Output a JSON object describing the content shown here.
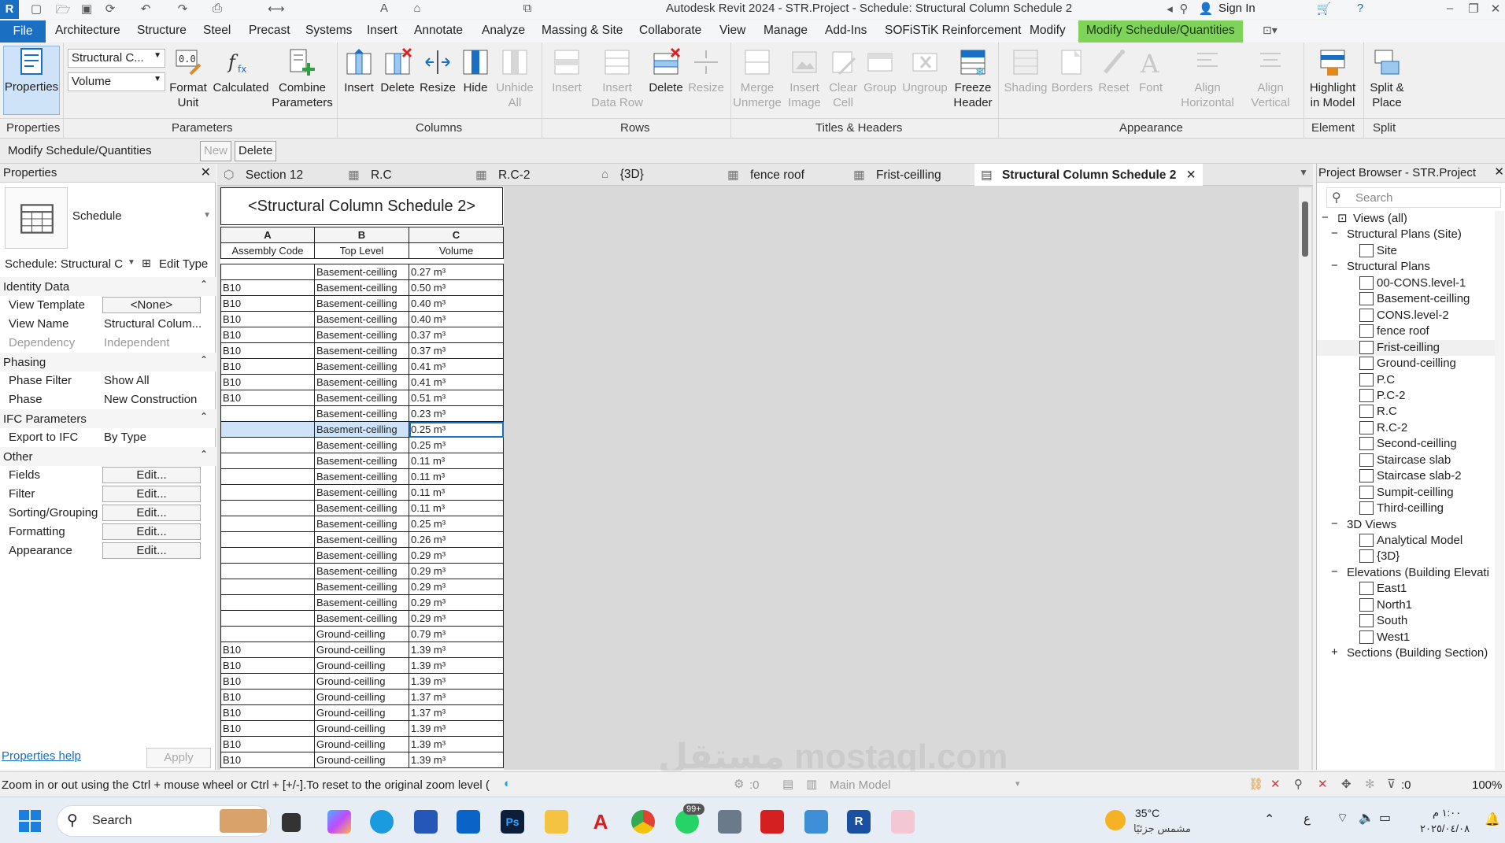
{
  "titlebar": {
    "title": "Autodesk Revit 2024 - STR.Project - Schedule: Structural Column Schedule 2",
    "sign_in": "Sign In"
  },
  "menu_tabs": [
    "File",
    "Architecture",
    "Structure",
    "Steel",
    "Precast",
    "Systems",
    "Insert",
    "Annotate",
    "Analyze",
    "Massing & Site",
    "Collaborate",
    "View",
    "Manage",
    "Add-Ins",
    "SOFiSTiK Reinforcement",
    "Modify",
    "Modify Schedule/Quantities"
  ],
  "ribbon": {
    "properties_label": "Properties",
    "param_dropdown1": "Structural C...",
    "param_dropdown2": "Volume",
    "format_unit": "Format Unit",
    "calculated": "Calculated",
    "combine_parameters": "Combine Parameters",
    "columns": [
      "Insert",
      "Delete",
      "Resize",
      "Hide",
      "Unhide All"
    ],
    "rows": [
      "Insert",
      "Insert Data Row",
      "Delete",
      "Resize"
    ],
    "titles": [
      "Merge Unmerge",
      "Insert Image",
      "Clear Cell",
      "Group",
      "Ungroup",
      "Freeze Header"
    ],
    "appearance": [
      "Shading",
      "Borders",
      "Reset",
      "Font",
      "Align Horizontal",
      "Align Vertical"
    ],
    "element": "Highlight in Model",
    "split": "Split & Place",
    "groups": [
      "Properties",
      "Parameters",
      "Columns",
      "Rows",
      "Titles & Headers",
      "Appearance",
      "Element",
      "Split"
    ]
  },
  "context_bar": {
    "label": "Modify Schedule/Quantities",
    "new": "New",
    "delete": "Delete"
  },
  "properties_panel": {
    "title": "Properties",
    "type_name": "Schedule",
    "selector": "Schedule: Structural C",
    "edit_type": "Edit Type",
    "sections": [
      {
        "name": "Identity Data",
        "rows": [
          [
            "View Template",
            "<None>"
          ],
          [
            "View Name",
            "Structural Colum..."
          ],
          [
            "Dependency",
            "Independent"
          ]
        ]
      },
      {
        "name": "Phasing",
        "rows": [
          [
            "Phase Filter",
            "Show All"
          ],
          [
            "Phase",
            "New Construction"
          ]
        ]
      },
      {
        "name": "IFC Parameters",
        "rows": [
          [
            "Export to IFC",
            "By Type"
          ]
        ]
      },
      {
        "name": "Other",
        "rows": [
          [
            "Fields",
            "Edit..."
          ],
          [
            "Filter",
            "Edit..."
          ],
          [
            "Sorting/Grouping",
            "Edit..."
          ],
          [
            "Formatting",
            "Edit..."
          ],
          [
            "Appearance",
            "Edit..."
          ]
        ]
      }
    ],
    "help_link": "Properties help",
    "apply": "Apply"
  },
  "view_tabs": [
    "Section 12",
    "R.C",
    "R.C-2",
    "{3D}",
    "fence roof",
    "Frist-ceilling",
    "Structural Column Schedule 2"
  ],
  "schedule": {
    "title": "<Structural Column Schedule 2>",
    "col_letters": [
      "A",
      "B",
      "C"
    ],
    "headers": [
      "Assembly Code",
      "Top Level",
      "Volume"
    ],
    "rows": [
      [
        "",
        "Basement-ceilling",
        "0.27 m³"
      ],
      [
        "B10",
        "Basement-ceilling",
        "0.50 m³"
      ],
      [
        "B10",
        "Basement-ceilling",
        "0.40 m³"
      ],
      [
        "B10",
        "Basement-ceilling",
        "0.40 m³"
      ],
      [
        "B10",
        "Basement-ceilling",
        "0.37 m³"
      ],
      [
        "B10",
        "Basement-ceilling",
        "0.37 m³"
      ],
      [
        "B10",
        "Basement-ceilling",
        "0.41 m³"
      ],
      [
        "B10",
        "Basement-ceilling",
        "0.41 m³"
      ],
      [
        "B10",
        "Basement-ceilling",
        "0.51 m³"
      ],
      [
        "",
        "Basement-ceilling",
        "0.23 m³"
      ],
      [
        "",
        "Basement-ceilling",
        "0.25 m³"
      ],
      [
        "",
        "Basement-ceilling",
        "0.25 m³"
      ],
      [
        "",
        "Basement-ceilling",
        "0.11 m³"
      ],
      [
        "",
        "Basement-ceilling",
        "0.11 m³"
      ],
      [
        "",
        "Basement-ceilling",
        "0.11 m³"
      ],
      [
        "",
        "Basement-ceilling",
        "0.11 m³"
      ],
      [
        "",
        "Basement-ceilling",
        "0.25 m³"
      ],
      [
        "",
        "Basement-ceilling",
        "0.26 m³"
      ],
      [
        "",
        "Basement-ceilling",
        "0.29 m³"
      ],
      [
        "",
        "Basement-ceilling",
        "0.29 m³"
      ],
      [
        "",
        "Basement-ceilling",
        "0.29 m³"
      ],
      [
        "",
        "Basement-ceilling",
        "0.29 m³"
      ],
      [
        "",
        "Basement-ceilling",
        "0.29 m³"
      ],
      [
        "",
        "Ground-ceilling",
        "0.79 m³"
      ],
      [
        "B10",
        "Ground-ceilling",
        "1.39 m³"
      ],
      [
        "B10",
        "Ground-ceilling",
        "1.39 m³"
      ],
      [
        "B10",
        "Ground-ceilling",
        "1.39 m³"
      ],
      [
        "B10",
        "Ground-ceilling",
        "1.37 m³"
      ],
      [
        "B10",
        "Ground-ceilling",
        "1.37 m³"
      ],
      [
        "B10",
        "Ground-ceilling",
        "1.39 m³"
      ],
      [
        "B10",
        "Ground-ceilling",
        "1.39 m³"
      ],
      [
        "B10",
        "Ground-ceilling",
        "1.39 m³"
      ]
    ],
    "selected_row": 10
  },
  "project_browser": {
    "title": "Project Browser - STR.Project",
    "search_placeholder": "Search",
    "items": [
      {
        "label": "Views (all)",
        "level": 0,
        "type": "root"
      },
      {
        "label": "Structural Plans (Site)",
        "level": 1,
        "type": "group"
      },
      {
        "label": "Site",
        "level": 2,
        "type": "view"
      },
      {
        "label": "Structural Plans",
        "level": 1,
        "type": "group"
      },
      {
        "label": "00-CONS.level-1",
        "level": 2,
        "type": "view"
      },
      {
        "label": "Basement-ceilling",
        "level": 2,
        "type": "view"
      },
      {
        "label": "CONS.level-2",
        "level": 2,
        "type": "view"
      },
      {
        "label": "fence roof",
        "level": 2,
        "type": "view"
      },
      {
        "label": "Frist-ceilling",
        "level": 2,
        "type": "view"
      },
      {
        "label": "Ground-ceilling",
        "level": 2,
        "type": "view"
      },
      {
        "label": "P.C",
        "level": 2,
        "type": "view"
      },
      {
        "label": "P.C-2",
        "level": 2,
        "type": "view"
      },
      {
        "label": "R.C",
        "level": 2,
        "type": "view"
      },
      {
        "label": "R.C-2",
        "level": 2,
        "type": "view"
      },
      {
        "label": "Second-ceilling",
        "level": 2,
        "type": "view"
      },
      {
        "label": "Staircase slab",
        "level": 2,
        "type": "view"
      },
      {
        "label": "Staircase slab-2",
        "level": 2,
        "type": "view"
      },
      {
        "label": "Sumpit-ceilling",
        "level": 2,
        "type": "view"
      },
      {
        "label": "Third-ceilling",
        "level": 2,
        "type": "view"
      },
      {
        "label": "3D Views",
        "level": 1,
        "type": "group"
      },
      {
        "label": "Analytical Model",
        "level": 2,
        "type": "view"
      },
      {
        "label": "{3D}",
        "level": 2,
        "type": "view"
      },
      {
        "label": "Elevations (Building Elevati",
        "level": 1,
        "type": "group"
      },
      {
        "label": "East1",
        "level": 2,
        "type": "view"
      },
      {
        "label": "North1",
        "level": 2,
        "type": "view"
      },
      {
        "label": "South",
        "level": 2,
        "type": "view"
      },
      {
        "label": "West1",
        "level": 2,
        "type": "view"
      },
      {
        "label": "Sections (Building Section)",
        "level": 1,
        "type": "collapsed"
      }
    ],
    "highlighted": 8
  },
  "status_bar": {
    "message": "Zoom in or out using the Ctrl + mouse wheel or Ctrl + [+/-].To reset to the original zoom level (",
    "workset_count": ":0",
    "model": "Main Model",
    "filter_count": ":0",
    "zoom": "100%"
  },
  "taskbar": {
    "search": "Search",
    "weather_temp": "35°C",
    "weather_desc": "مشمس جزئيًا",
    "lang": "ع",
    "time": "١:٠٠ م",
    "date": "٢٠٢٥/٠٤/٠٨",
    "badge": "99+"
  },
  "watermark": "مستقل mostaql.com",
  "colors": {
    "accent_blue": "#1b6fc2",
    "context_tab_green": "#7fd35a",
    "selection": "#cfe3f8"
  }
}
